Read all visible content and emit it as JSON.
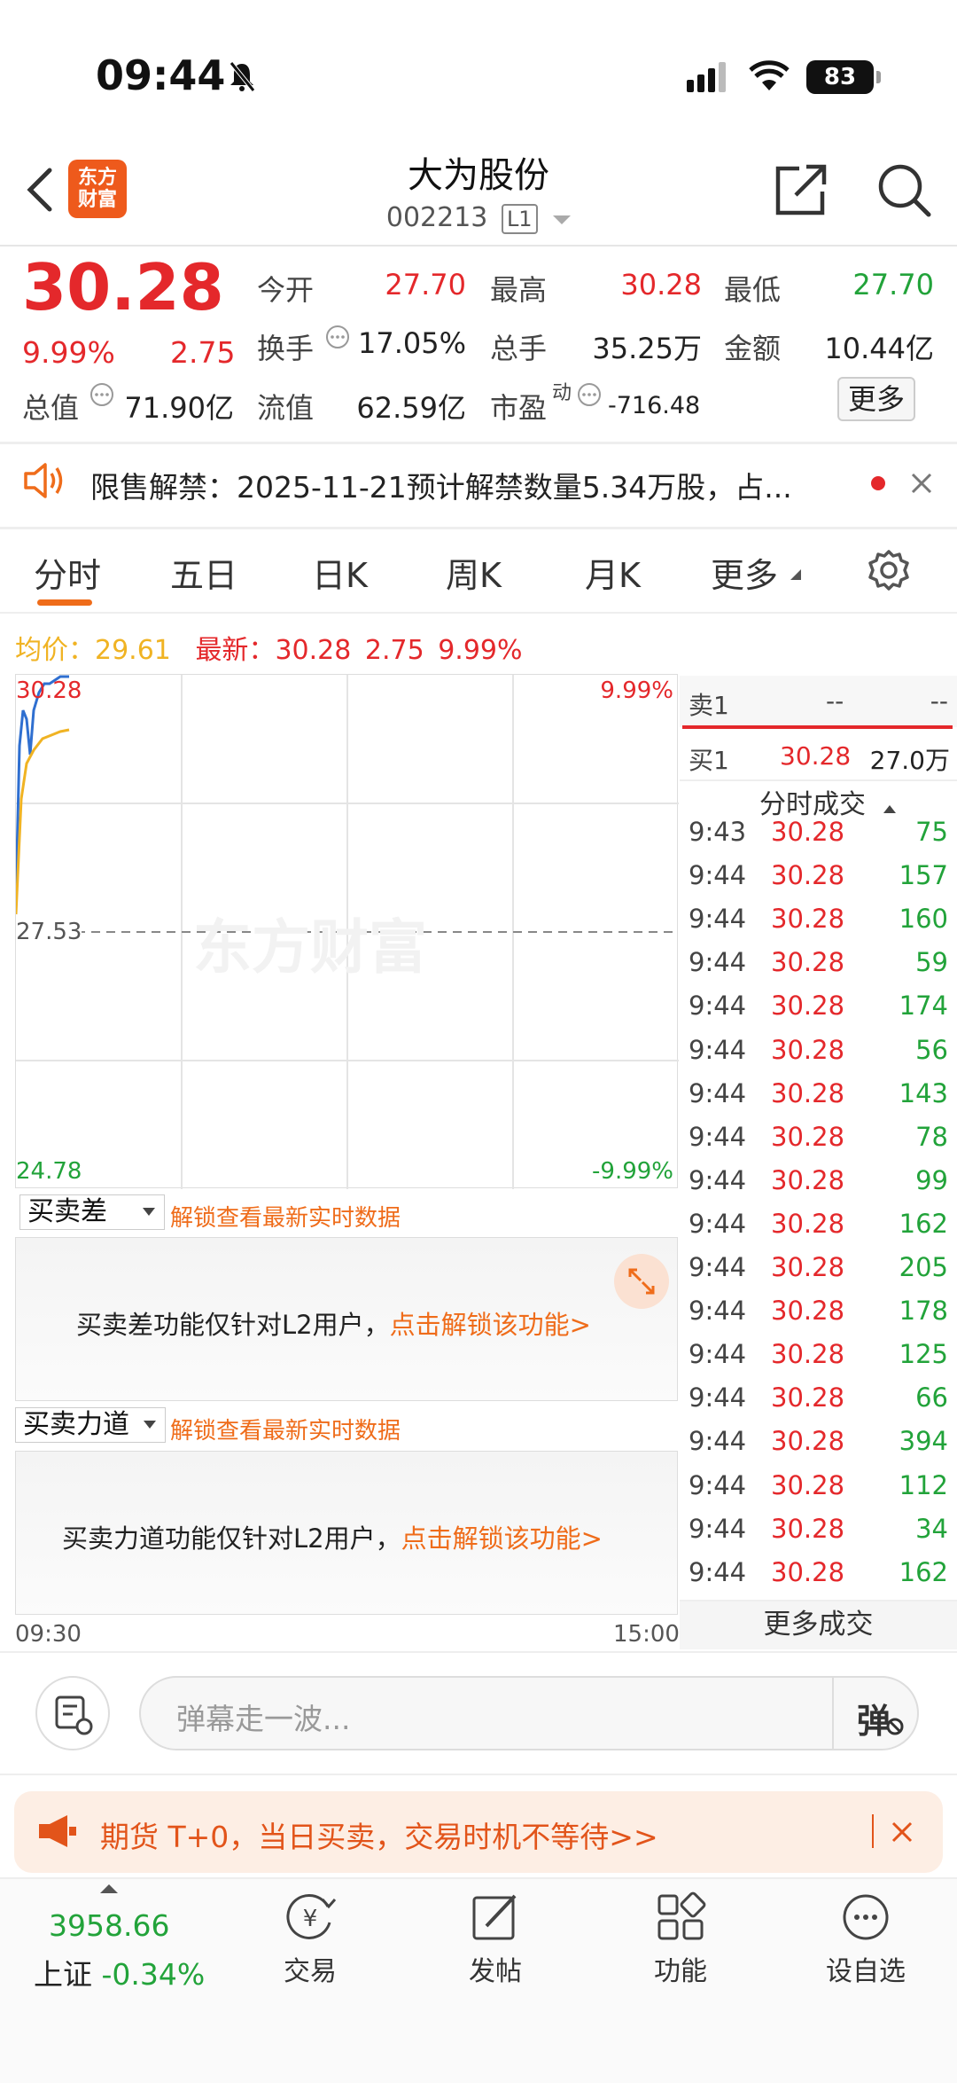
{
  "status_bar": {
    "time": "09:44",
    "battery": "83"
  },
  "header": {
    "logo_line1": "东方",
    "logo_line2": "财富",
    "stock_name": "大为股份",
    "stock_code": "002213",
    "level_badge": "L1"
  },
  "quote": {
    "price": "30.28",
    "change_pct": "9.99%",
    "change_amt": "2.75",
    "fields": {
      "open_label": "今开",
      "open_value": "27.70",
      "high_label": "最高",
      "high_value": "30.28",
      "low_label": "最低",
      "low_value": "27.70",
      "turnover_label": "换手",
      "turnover_value": "17.05%",
      "volume_label": "总手",
      "volume_value": "35.25万",
      "amount_label": "金额",
      "amount_value": "10.44亿",
      "mktcap_label": "总值",
      "mktcap_value": "71.90亿",
      "float_label": "流值",
      "float_value": "62.59亿",
      "pe_label": "市盈",
      "pe_sup": "动",
      "pe_value": "-716.48"
    },
    "more_label": "更多"
  },
  "notice": {
    "text": "限售解禁：2025-11-21预计解禁数量5.34万股，占..."
  },
  "tabs": [
    "分时",
    "五日",
    "日K",
    "周K",
    "月K",
    "更多"
  ],
  "chart": {
    "avg_label": "均价：29.61",
    "latest_label": "最新：",
    "latest_price": "30.28",
    "latest_chg": "2.75",
    "latest_pct": "9.99%",
    "top_price": "30.28",
    "top_pct": "9.99%",
    "mid_price": "27.53",
    "bottom_price": "24.78",
    "bottom_pct": "-9.99%",
    "watermark": "东方财富",
    "time_start": "09:30",
    "time_end": "15:00",
    "colors": {
      "price_line": "#2f6fd0",
      "avg_line": "#f0b323"
    }
  },
  "l2_panels": [
    {
      "dropdown": "买卖差",
      "hint": "解锁查看最新实时数据",
      "msg": "买卖差功能仅针对L2用户，",
      "link": "点击解锁该功能>"
    },
    {
      "dropdown": "买卖力道",
      "hint": "解锁查看最新实时数据",
      "msg": "买卖力道功能仅针对L2用户，",
      "link": "点击解锁该功能>"
    }
  ],
  "order_book": {
    "sell1_label": "卖1",
    "sell1_price": "--",
    "sell1_vol": "--",
    "buy1_label": "买1",
    "buy1_price": "30.28",
    "buy1_vol": "27.0万"
  },
  "trades": {
    "header": "分时成交",
    "rows": [
      {
        "time": "9:43",
        "price": "30.28",
        "vol": "75"
      },
      {
        "time": "9:44",
        "price": "30.28",
        "vol": "157"
      },
      {
        "time": "9:44",
        "price": "30.28",
        "vol": "160"
      },
      {
        "time": "9:44",
        "price": "30.28",
        "vol": "59"
      },
      {
        "time": "9:44",
        "price": "30.28",
        "vol": "174"
      },
      {
        "time": "9:44",
        "price": "30.28",
        "vol": "56"
      },
      {
        "time": "9:44",
        "price": "30.28",
        "vol": "143"
      },
      {
        "time": "9:44",
        "price": "30.28",
        "vol": "78"
      },
      {
        "time": "9:44",
        "price": "30.28",
        "vol": "99"
      },
      {
        "time": "9:44",
        "price": "30.28",
        "vol": "162"
      },
      {
        "time": "9:44",
        "price": "30.28",
        "vol": "205"
      },
      {
        "time": "9:44",
        "price": "30.28",
        "vol": "178"
      },
      {
        "time": "9:44",
        "price": "30.28",
        "vol": "125"
      },
      {
        "time": "9:44",
        "price": "30.28",
        "vol": "66"
      },
      {
        "time": "9:44",
        "price": "30.28",
        "vol": "394"
      },
      {
        "time": "9:44",
        "price": "30.28",
        "vol": "112"
      },
      {
        "time": "9:44",
        "price": "30.28",
        "vol": "34"
      },
      {
        "time": "9:44",
        "price": "30.28",
        "vol": "162"
      }
    ],
    "more_label": "更多成交"
  },
  "bullet": {
    "placeholder": "弹幕走一波...",
    "send_label": "弹"
  },
  "promo": {
    "text": "期货 T+0，当日买卖，交易时机不等待>>"
  },
  "bottom_nav": {
    "index_value": "3958.66",
    "index_name": "上证",
    "index_change": "-0.34%",
    "items": [
      "交易",
      "发帖",
      "功能",
      "设自选"
    ]
  }
}
